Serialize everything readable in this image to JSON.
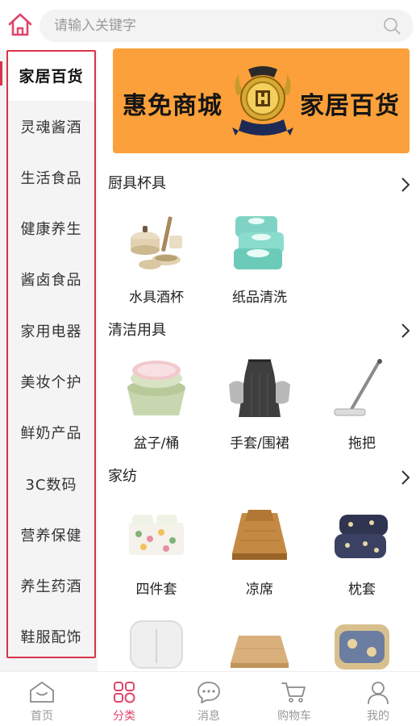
{
  "search": {
    "placeholder": "请输入关键字"
  },
  "banner": {
    "left_text": "惠免商城",
    "right_text": "家居百货"
  },
  "sidebar": {
    "items": [
      {
        "label": "家居百货",
        "active": true
      },
      {
        "label": "灵魂酱酒"
      },
      {
        "label": "生活食品"
      },
      {
        "label": "健康养生"
      },
      {
        "label": "酱卤食品"
      },
      {
        "label": "家用电器"
      },
      {
        "label": "美妆个护"
      },
      {
        "label": "鲜奶产品"
      },
      {
        "label": "3C数码"
      },
      {
        "label": "营养保健"
      },
      {
        "label": "养生药酒"
      },
      {
        "label": "鞋服配饰"
      }
    ]
  },
  "sections": [
    {
      "title": "厨具杯具",
      "products": [
        {
          "label": "水具酒杯",
          "icon": "cookware-image"
        },
        {
          "label": "纸品清洗",
          "icon": "wet-wipes-image"
        }
      ]
    },
    {
      "title": "清洁用具",
      "products": [
        {
          "label": "盆子/桶",
          "icon": "basins-image"
        },
        {
          "label": "手套/围裙",
          "icon": "apron-gloves-image"
        },
        {
          "label": "拖把",
          "icon": "mop-image"
        }
      ]
    },
    {
      "title": "家纺",
      "products": [
        {
          "label": "四件套",
          "icon": "bedding-set-image"
        },
        {
          "label": "凉席",
          "icon": "summer-mat-image"
        },
        {
          "label": "枕套",
          "icon": "pillowcase-image"
        },
        {
          "label": "",
          "icon": "pillow-image"
        },
        {
          "label": "",
          "icon": "mat-image"
        },
        {
          "label": "",
          "icon": "blanket-image"
        }
      ]
    }
  ],
  "tabbar": {
    "items": [
      {
        "label": "首页",
        "icon": "home-icon"
      },
      {
        "label": "分类",
        "icon": "category-icon",
        "active": true
      },
      {
        "label": "消息",
        "icon": "message-icon"
      },
      {
        "label": "购物车",
        "icon": "cart-icon"
      },
      {
        "label": "我的",
        "icon": "user-icon"
      }
    ]
  },
  "colors": {
    "accent": "#e0456a",
    "frame": "#d9334a",
    "banner": "#fba03a"
  }
}
